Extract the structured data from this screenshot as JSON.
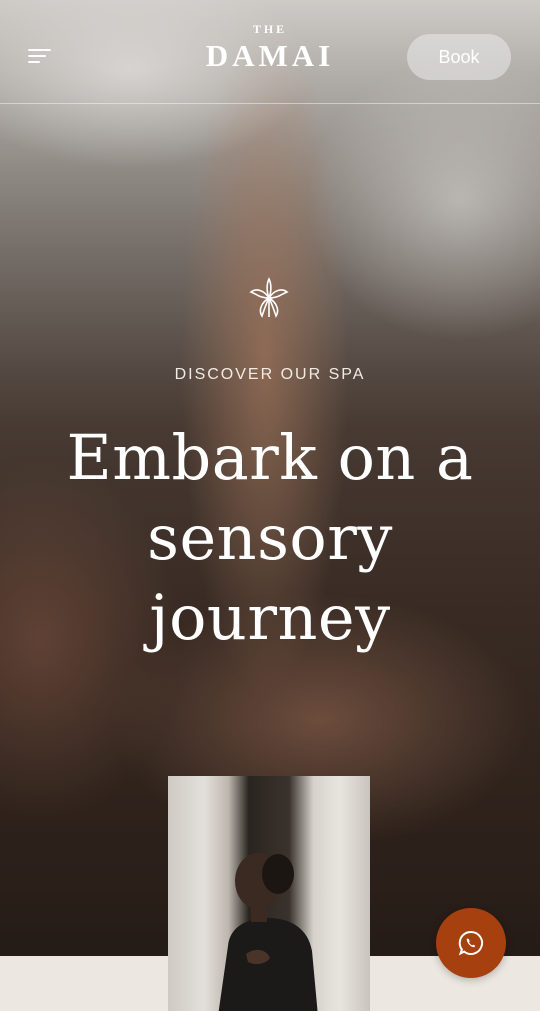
{
  "header": {
    "menu_icon": "hamburger-menu-icon",
    "logo_prefix": "THE",
    "logo_name": "DAMAI",
    "book_label": "Book"
  },
  "hero": {
    "emblem_icon": "lotus-emblem-icon",
    "eyebrow": "DISCOVER OUR SPA",
    "headline_line1": "Embark on a",
    "headline_line2": "sensory",
    "headline_line3": "journey"
  },
  "floating": {
    "whatsapp_icon": "whatsapp-icon"
  },
  "colors": {
    "accent": "#a7400f",
    "strip_background": "#ece7e0",
    "text_light": "#ffffff"
  }
}
